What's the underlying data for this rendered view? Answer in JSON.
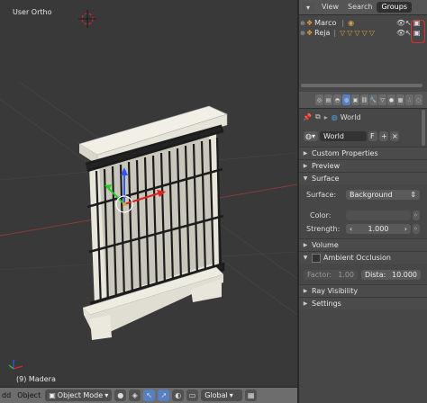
{
  "viewport": {
    "view_label": "User Ortho",
    "object_label": "(9) Madera"
  },
  "header3d": {
    "left_text": "dd",
    "object_menu": "Object",
    "mode": "Object Mode",
    "orientation": "Global"
  },
  "outliner": {
    "tabs": [
      "View",
      "Search",
      "Groups"
    ],
    "active_tab": "Groups",
    "rows": [
      {
        "name": "Marco"
      },
      {
        "name": "Reja"
      }
    ]
  },
  "properties": {
    "breadcrumb": "World",
    "world_name": "World",
    "world_f": "F",
    "panels": {
      "custom_props": "Custom Properties",
      "preview": "Preview",
      "surface": "Surface",
      "volume": "Volume",
      "ao": "Ambient Occlusion",
      "ray_vis": "Ray Visibility",
      "settings": "Settings"
    },
    "surface": {
      "label": "Surface:",
      "value": "Background",
      "color_label": "Color:",
      "strength_label": "Strength:",
      "strength_value": "1.000"
    },
    "ao": {
      "factor_label": "Factor:",
      "factor_value": "1.00",
      "distance_label": "Dista:",
      "distance_value": "10.000"
    }
  },
  "colors": {
    "accent": "#5680c2",
    "highlight_red": "#e03030"
  }
}
